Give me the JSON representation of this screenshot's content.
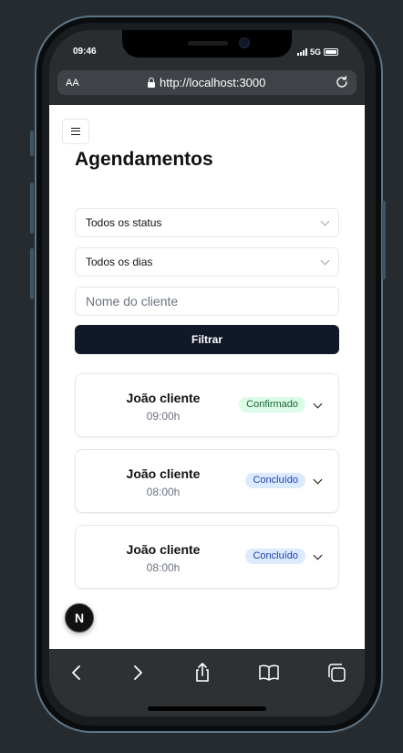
{
  "status_bar": {
    "time": "09:46",
    "network": "5G"
  },
  "browser": {
    "text_size_label": "AA",
    "url": "http://localhost:3000",
    "toolbar": [
      "back-icon",
      "forward-icon",
      "share-icon",
      "bookmarks-icon",
      "tabs-icon"
    ]
  },
  "page": {
    "title": "Agendamentos",
    "filters": {
      "status_select": "Todos os status",
      "day_select": "Todos os dias",
      "client_placeholder": "Nome do cliente",
      "filter_button": "Filtrar"
    },
    "appointments": [
      {
        "name": "João cliente",
        "time": "09:00h",
        "status": "Confirmado"
      },
      {
        "name": "João cliente",
        "time": "08:00h",
        "status": "Concluído"
      },
      {
        "name": "João cliente",
        "time": "08:00h",
        "status": "Concluído"
      }
    ],
    "dev_badge": "N"
  },
  "colors": {
    "primary_button": "#111827",
    "confirmed_badge_bg": "#dcfce7",
    "confirmed_badge_text": "#166534",
    "done_badge_bg": "#dbeafe",
    "done_badge_text": "#1e40af"
  }
}
